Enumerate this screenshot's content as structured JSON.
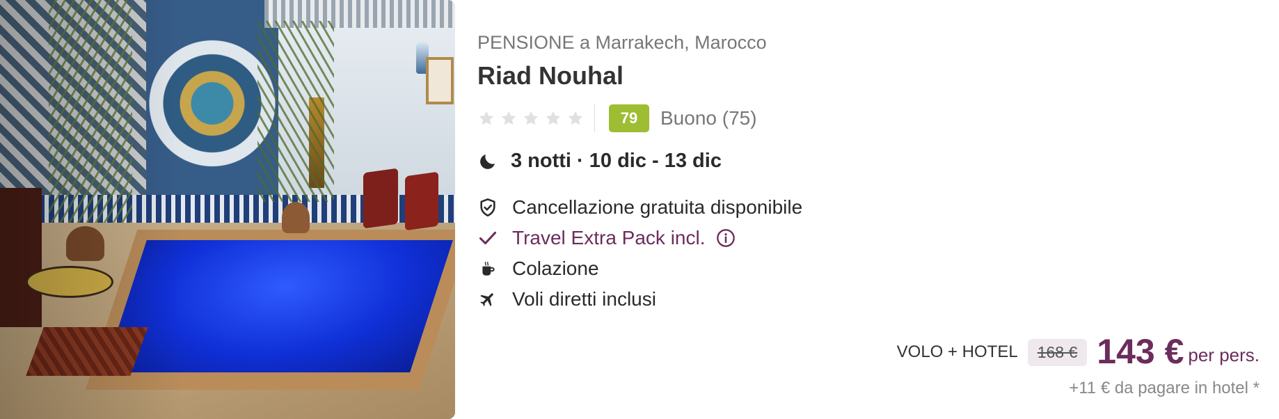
{
  "hotel": {
    "type_location": "PENSIONE a Marrakech, Marocco",
    "name": "Riad Nouhal",
    "stars_filled": 0,
    "stars_total": 5,
    "score": "79",
    "score_text": "Buono (75)",
    "score_color": "#9ebd33"
  },
  "stay": {
    "dates_text": "3 notti · 10 dic - 13 dic"
  },
  "features": [
    {
      "icon": "shield-check-icon",
      "text": "Cancellazione gratuita disponibile"
    },
    {
      "icon": "checkmark-icon",
      "text": "Travel Extra Pack incl.",
      "highlight": true
    },
    {
      "icon": "coffee-cup-icon",
      "text": "Colazione"
    },
    {
      "icon": "airplane-icon",
      "text": "Voli diretti inclusi"
    }
  ],
  "price": {
    "package_label": "VOLO + HOTEL",
    "old_price": "168 €",
    "new_price": "143 €",
    "per_person": "per pers.",
    "hotel_fee": "+11 € da pagare in hotel *"
  },
  "colors": {
    "brand_purple": "#6b2d5c",
    "star_empty": "#e0e0e0"
  }
}
